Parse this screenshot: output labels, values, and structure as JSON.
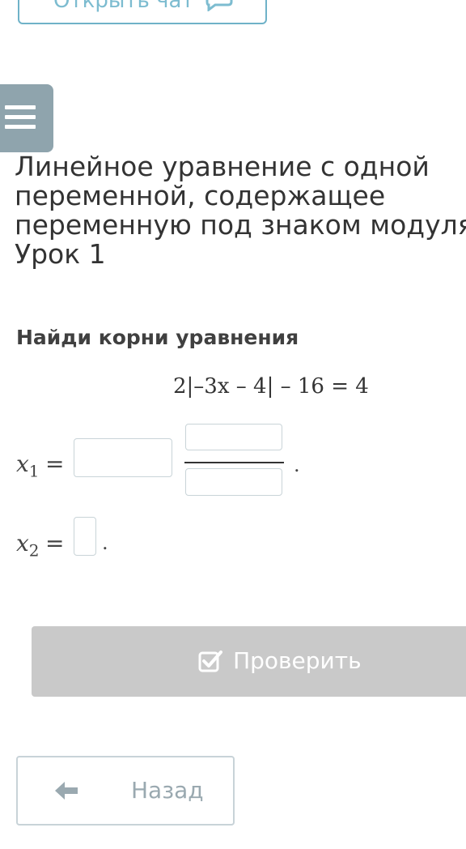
{
  "top_button": {
    "label": "Открыть чат",
    "icon": "chat-icon"
  },
  "menu": {
    "icon": "hamburger-menu-icon"
  },
  "lesson": {
    "title_lines": [
      "Линейное уравнение с одной",
      "переменной, содержащее",
      "переменную под знаком модуля.",
      "Урок 1"
    ]
  },
  "task": {
    "heading": "Найди корни уравнения",
    "equation": "2|–3x – 4| – 16 = 4",
    "x1": {
      "var": "x",
      "sub": "1",
      "eq": "=",
      "whole_value": "",
      "numerator_value": "",
      "denominator_value": "",
      "end": "."
    },
    "x2": {
      "var": "x",
      "sub": "2",
      "eq": "=",
      "value": "",
      "end": "."
    }
  },
  "actions": {
    "check_label": "Проверить",
    "check_icon": "checkbox-check-icon",
    "back_label": "Назад",
    "back_icon": "arrow-left-icon"
  },
  "colors": {
    "accent": "#6fb2c8",
    "menu_bg": "#8fa4ad",
    "disabled_button": "#c9c9c9"
  }
}
